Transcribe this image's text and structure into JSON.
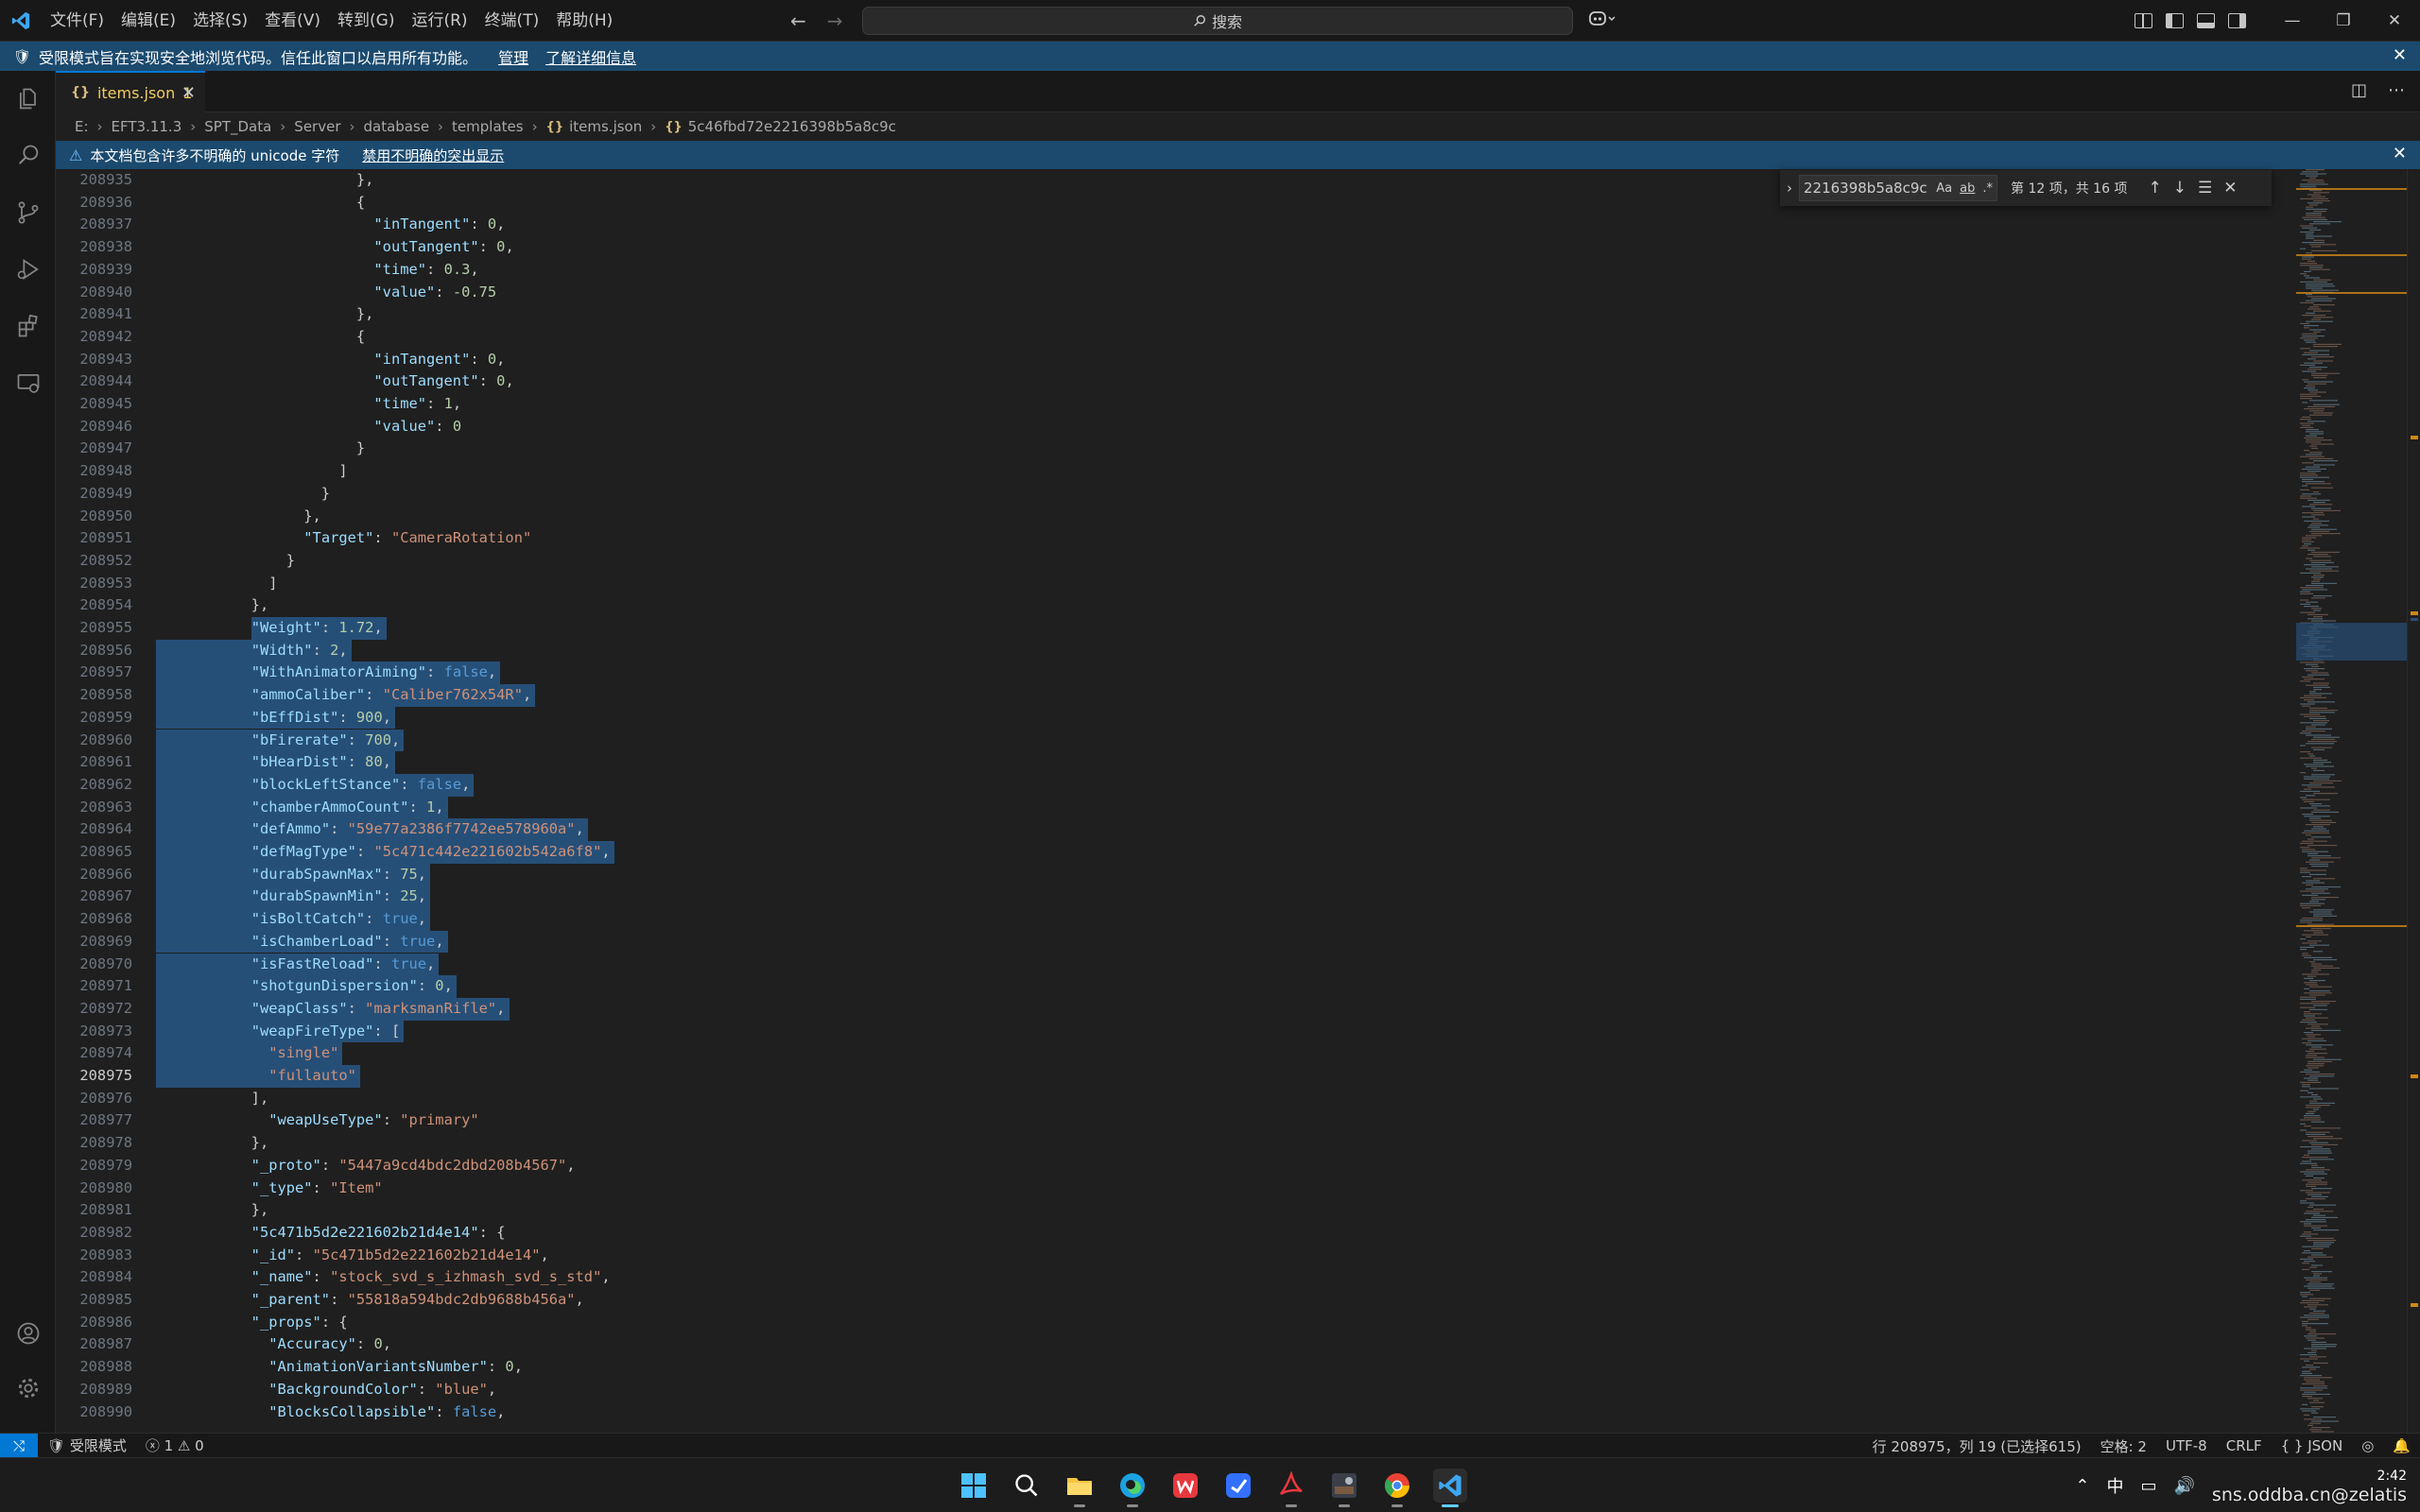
{
  "titlebar": {
    "menu": [
      "文件(F)",
      "编辑(E)",
      "选择(S)",
      "查看(V)",
      "转到(G)",
      "运行(R)",
      "终端(T)",
      "帮助(H)"
    ],
    "search_placeholder": "搜索"
  },
  "restricted_banner": {
    "message": "受限模式旨在实现安全地浏览代码。信任此窗口以启用所有功能。",
    "manage_link": "管理",
    "learn_more_link": "了解详细信息"
  },
  "tab": {
    "label": "items.json",
    "problems": "1"
  },
  "breadcrumb": [
    "E:",
    "EFT3.11.3",
    "SPT_Data",
    "Server",
    "database",
    "templates",
    "items.json",
    "5c46fbd72e2216398b5a8c9c"
  ],
  "unicode_banner": {
    "message": "本文档包含许多不明确的 unicode 字符",
    "action_link": "禁用不明确的突出显示"
  },
  "find_widget": {
    "query": "2216398b5a8c9c",
    "match_case": "Aa",
    "whole_word": "ab",
    "regex": ".*",
    "count": "第 12 项，共 16 项"
  },
  "editor": {
    "active_line": "208975",
    "lines": [
      {
        "n": "208935",
        "t": [
          [
            "p",
            "              },"
          ]
        ]
      },
      {
        "n": "208936",
        "t": [
          [
            "p",
            "              {"
          ]
        ]
      },
      {
        "n": "208937",
        "t": [
          [
            "p",
            "                "
          ],
          [
            "k",
            "\"inTangent\""
          ],
          [
            "p",
            ": "
          ],
          [
            "n",
            "0"
          ],
          [
            "p",
            ","
          ]
        ]
      },
      {
        "n": "208938",
        "t": [
          [
            "p",
            "                "
          ],
          [
            "k",
            "\"outTangent\""
          ],
          [
            "p",
            ": "
          ],
          [
            "n",
            "0"
          ],
          [
            "p",
            ","
          ]
        ]
      },
      {
        "n": "208939",
        "t": [
          [
            "p",
            "                "
          ],
          [
            "k",
            "\"time\""
          ],
          [
            "p",
            ": "
          ],
          [
            "n",
            "0.3"
          ],
          [
            "p",
            ","
          ]
        ]
      },
      {
        "n": "208940",
        "t": [
          [
            "p",
            "                "
          ],
          [
            "k",
            "\"value\""
          ],
          [
            "p",
            ": "
          ],
          [
            "n",
            "-0.75"
          ]
        ]
      },
      {
        "n": "208941",
        "t": [
          [
            "p",
            "              },"
          ]
        ]
      },
      {
        "n": "208942",
        "t": [
          [
            "p",
            "              {"
          ]
        ]
      },
      {
        "n": "208943",
        "t": [
          [
            "p",
            "                "
          ],
          [
            "k",
            "\"inTangent\""
          ],
          [
            "p",
            ": "
          ],
          [
            "n",
            "0"
          ],
          [
            "p",
            ","
          ]
        ]
      },
      {
        "n": "208944",
        "t": [
          [
            "p",
            "                "
          ],
          [
            "k",
            "\"outTangent\""
          ],
          [
            "p",
            ": "
          ],
          [
            "n",
            "0"
          ],
          [
            "p",
            ","
          ]
        ]
      },
      {
        "n": "208945",
        "t": [
          [
            "p",
            "                "
          ],
          [
            "k",
            "\"time\""
          ],
          [
            "p",
            ": "
          ],
          [
            "n",
            "1"
          ],
          [
            "p",
            ","
          ]
        ]
      },
      {
        "n": "208946",
        "t": [
          [
            "p",
            "                "
          ],
          [
            "k",
            "\"value\""
          ],
          [
            "p",
            ": "
          ],
          [
            "n",
            "0"
          ]
        ]
      },
      {
        "n": "208947",
        "t": [
          [
            "p",
            "              }"
          ]
        ]
      },
      {
        "n": "208948",
        "t": [
          [
            "p",
            "            ]"
          ]
        ]
      },
      {
        "n": "208949",
        "t": [
          [
            "p",
            "          }"
          ]
        ]
      },
      {
        "n": "208950",
        "t": [
          [
            "p",
            "        },"
          ]
        ]
      },
      {
        "n": "208951",
        "t": [
          [
            "p",
            "        "
          ],
          [
            "k",
            "\"Target\""
          ],
          [
            "p",
            ": "
          ],
          [
            "s",
            "\"CameraRotation\""
          ]
        ]
      },
      {
        "n": "208952",
        "t": [
          [
            "p",
            "      }"
          ]
        ]
      },
      {
        "n": "208953",
        "t": [
          [
            "p",
            "    ]"
          ]
        ]
      },
      {
        "n": "208954",
        "t": [
          [
            "p",
            "  },"
          ]
        ]
      },
      {
        "n": "208955",
        "sel": true,
        "t": [
          [
            "p",
            "  "
          ],
          [
            "k",
            "\"Weight\""
          ],
          [
            "p",
            ": "
          ],
          [
            "n",
            "1.72"
          ],
          [
            "p",
            ","
          ]
        ]
      },
      {
        "n": "208956",
        "sel": true,
        "t": [
          [
            "p",
            "  "
          ],
          [
            "k",
            "\"Width\""
          ],
          [
            "p",
            ": "
          ],
          [
            "n",
            "2"
          ],
          [
            "p",
            ","
          ]
        ]
      },
      {
        "n": "208957",
        "sel": true,
        "t": [
          [
            "p",
            "  "
          ],
          [
            "k",
            "\"WithAnimatorAiming\""
          ],
          [
            "p",
            ": "
          ],
          [
            "b",
            "false"
          ],
          [
            "p",
            ","
          ]
        ]
      },
      {
        "n": "208958",
        "sel": true,
        "t": [
          [
            "p",
            "  "
          ],
          [
            "k",
            "\"ammoCaliber\""
          ],
          [
            "p",
            ": "
          ],
          [
            "s",
            "\"Caliber762x54R\""
          ],
          [
            "p",
            ","
          ]
        ]
      },
      {
        "n": "208959",
        "sel": true,
        "t": [
          [
            "p",
            "  "
          ],
          [
            "k",
            "\"bEffDist\""
          ],
          [
            "p",
            ": "
          ],
          [
            "n",
            "900"
          ],
          [
            "p",
            ","
          ]
        ]
      },
      {
        "n": "208960",
        "sel": true,
        "t": [
          [
            "p",
            "  "
          ],
          [
            "k",
            "\"bFirerate\""
          ],
          [
            "p",
            ": "
          ],
          [
            "n",
            "700"
          ],
          [
            "p",
            ","
          ]
        ]
      },
      {
        "n": "208961",
        "sel": true,
        "t": [
          [
            "p",
            "  "
          ],
          [
            "k",
            "\"bHearDist\""
          ],
          [
            "p",
            ": "
          ],
          [
            "n",
            "80"
          ],
          [
            "p",
            ","
          ]
        ]
      },
      {
        "n": "208962",
        "sel": true,
        "t": [
          [
            "p",
            "  "
          ],
          [
            "k",
            "\"blockLeftStance\""
          ],
          [
            "p",
            ": "
          ],
          [
            "b",
            "false"
          ],
          [
            "p",
            ","
          ]
        ]
      },
      {
        "n": "208963",
        "sel": true,
        "t": [
          [
            "p",
            "  "
          ],
          [
            "k",
            "\"chamberAmmoCount\""
          ],
          [
            "p",
            ": "
          ],
          [
            "n",
            "1"
          ],
          [
            "p",
            ","
          ]
        ]
      },
      {
        "n": "208964",
        "sel": true,
        "t": [
          [
            "p",
            "  "
          ],
          [
            "k",
            "\"defAmmo\""
          ],
          [
            "p",
            ": "
          ],
          [
            "s",
            "\"59e77a2386f7742ee578960a\""
          ],
          [
            "p",
            ","
          ]
        ]
      },
      {
        "n": "208965",
        "sel": true,
        "t": [
          [
            "p",
            "  "
          ],
          [
            "k",
            "\"defMagType\""
          ],
          [
            "p",
            ": "
          ],
          [
            "s",
            "\"5c471c442e221602b542a6f8\""
          ],
          [
            "p",
            ","
          ]
        ]
      },
      {
        "n": "208966",
        "sel": true,
        "t": [
          [
            "p",
            "  "
          ],
          [
            "k",
            "\"durabSpawnMax\""
          ],
          [
            "p",
            ": "
          ],
          [
            "n",
            "75"
          ],
          [
            "p",
            ","
          ]
        ]
      },
      {
        "n": "208967",
        "sel": true,
        "t": [
          [
            "p",
            "  "
          ],
          [
            "k",
            "\"durabSpawnMin\""
          ],
          [
            "p",
            ": "
          ],
          [
            "n",
            "25"
          ],
          [
            "p",
            ","
          ]
        ]
      },
      {
        "n": "208968",
        "sel": true,
        "t": [
          [
            "p",
            "  "
          ],
          [
            "k",
            "\"isBoltCatch\""
          ],
          [
            "p",
            ": "
          ],
          [
            "b",
            "true"
          ],
          [
            "p",
            ","
          ]
        ]
      },
      {
        "n": "208969",
        "sel": true,
        "t": [
          [
            "p",
            "  "
          ],
          [
            "k",
            "\"isChamberLoad\""
          ],
          [
            "p",
            ": "
          ],
          [
            "b",
            "true"
          ],
          [
            "p",
            ","
          ]
        ]
      },
      {
        "n": "208970",
        "sel": true,
        "t": [
          [
            "p",
            "  "
          ],
          [
            "k",
            "\"isFastReload\""
          ],
          [
            "p",
            ": "
          ],
          [
            "b",
            "true"
          ],
          [
            "p",
            ","
          ]
        ]
      },
      {
        "n": "208971",
        "sel": true,
        "t": [
          [
            "p",
            "  "
          ],
          [
            "k",
            "\"shotgunDispersion\""
          ],
          [
            "p",
            ": "
          ],
          [
            "n",
            "0"
          ],
          [
            "p",
            ","
          ]
        ]
      },
      {
        "n": "208972",
        "sel": true,
        "t": [
          [
            "p",
            "  "
          ],
          [
            "k",
            "\"weapClass\""
          ],
          [
            "p",
            ": "
          ],
          [
            "s",
            "\"marksmanRifle\""
          ],
          [
            "p",
            ","
          ]
        ]
      },
      {
        "n": "208973",
        "sel": true,
        "t": [
          [
            "p",
            "  "
          ],
          [
            "k",
            "\"weapFireType\""
          ],
          [
            "p",
            ": ["
          ]
        ]
      },
      {
        "n": "208974",
        "sel": true,
        "t": [
          [
            "p",
            "    "
          ],
          [
            "s",
            "\"single\""
          ]
        ]
      },
      {
        "n": "208975",
        "sel": true,
        "t": [
          [
            "p",
            "    "
          ],
          [
            "s",
            "\"fullauto\""
          ]
        ]
      },
      {
        "n": "208976",
        "t": [
          [
            "p",
            "  ],"
          ]
        ]
      },
      {
        "n": "208977",
        "t": [
          [
            "p",
            "  "
          ],
          [
            "k",
            "\"weapUseType\""
          ],
          [
            "p",
            ": "
          ],
          [
            "s",
            "\"primary\""
          ]
        ]
      },
      {
        "n": "208978",
        "t": [
          [
            "p",
            "},"
          ]
        ]
      },
      {
        "n": "208979",
        "t": [
          [
            "k",
            "\"_proto\""
          ],
          [
            "p",
            ": "
          ],
          [
            "s",
            "\"5447a9cd4bdc2dbd208b4567\""
          ],
          [
            "p",
            ","
          ]
        ]
      },
      {
        "n": "208980",
        "t": [
          [
            "k",
            "\"_type\""
          ],
          [
            "p",
            ": "
          ],
          [
            "s",
            "\"Item\""
          ]
        ]
      },
      {
        "n": "208981",
        "t": [
          [
            "p",
            "},"
          ]
        ]
      },
      {
        "n": "208982",
        "t": [
          [
            "k",
            "\"5c471b5d2e221602b21d4e14\""
          ],
          [
            "p",
            ": {"
          ]
        ]
      },
      {
        "n": "208983",
        "t": [
          [
            "k",
            "\"_id\""
          ],
          [
            "p",
            ": "
          ],
          [
            "s",
            "\"5c471b5d2e221602b21d4e14\""
          ],
          [
            "p",
            ","
          ]
        ]
      },
      {
        "n": "208984",
        "t": [
          [
            "k",
            "\"_name\""
          ],
          [
            "p",
            ": "
          ],
          [
            "s",
            "\"stock_svd_s_izhmash_svd_s_std\""
          ],
          [
            "p",
            ","
          ]
        ]
      },
      {
        "n": "208985",
        "t": [
          [
            "k",
            "\"_parent\""
          ],
          [
            "p",
            ": "
          ],
          [
            "s",
            "\"55818a594bdc2db9688b456a\""
          ],
          [
            "p",
            ","
          ]
        ]
      },
      {
        "n": "208986",
        "t": [
          [
            "k",
            "\"_props\""
          ],
          [
            "p",
            ": {"
          ]
        ]
      },
      {
        "n": "208987",
        "t": [
          [
            "p",
            "  "
          ],
          [
            "k",
            "\"Accuracy\""
          ],
          [
            "p",
            ": "
          ],
          [
            "n",
            "0"
          ],
          [
            "p",
            ","
          ]
        ]
      },
      {
        "n": "208988",
        "t": [
          [
            "p",
            "  "
          ],
          [
            "k",
            "\"AnimationVariantsNumber\""
          ],
          [
            "p",
            ": "
          ],
          [
            "n",
            "0"
          ],
          [
            "p",
            ","
          ]
        ]
      },
      {
        "n": "208989",
        "t": [
          [
            "p",
            "  "
          ],
          [
            "k",
            "\"BackgroundColor\""
          ],
          [
            "p",
            ": "
          ],
          [
            "s",
            "\"blue\""
          ],
          [
            "p",
            ","
          ]
        ]
      },
      {
        "n": "208990",
        "t": [
          [
            "p",
            "  "
          ],
          [
            "k",
            "\"BlocksCollapsible\""
          ],
          [
            "p",
            ": "
          ],
          [
            "b",
            "false"
          ],
          [
            "p",
            ","
          ]
        ]
      }
    ]
  },
  "statusbar": {
    "restricted": "受限模式",
    "errors": "1",
    "warnings": "0",
    "position": "行 208975，列 19 (已选择615)",
    "spaces": "空格: 2",
    "encoding": "UTF-8",
    "eol": "CRLF",
    "language": "JSON"
  },
  "taskbar": {
    "ime": "中",
    "time": "2:42",
    "watermark": "sns.oddba.cn@zelatis"
  },
  "colors": {
    "accent": "#0078d4",
    "banner": "#1b4a6e",
    "selection": "#264f78"
  }
}
